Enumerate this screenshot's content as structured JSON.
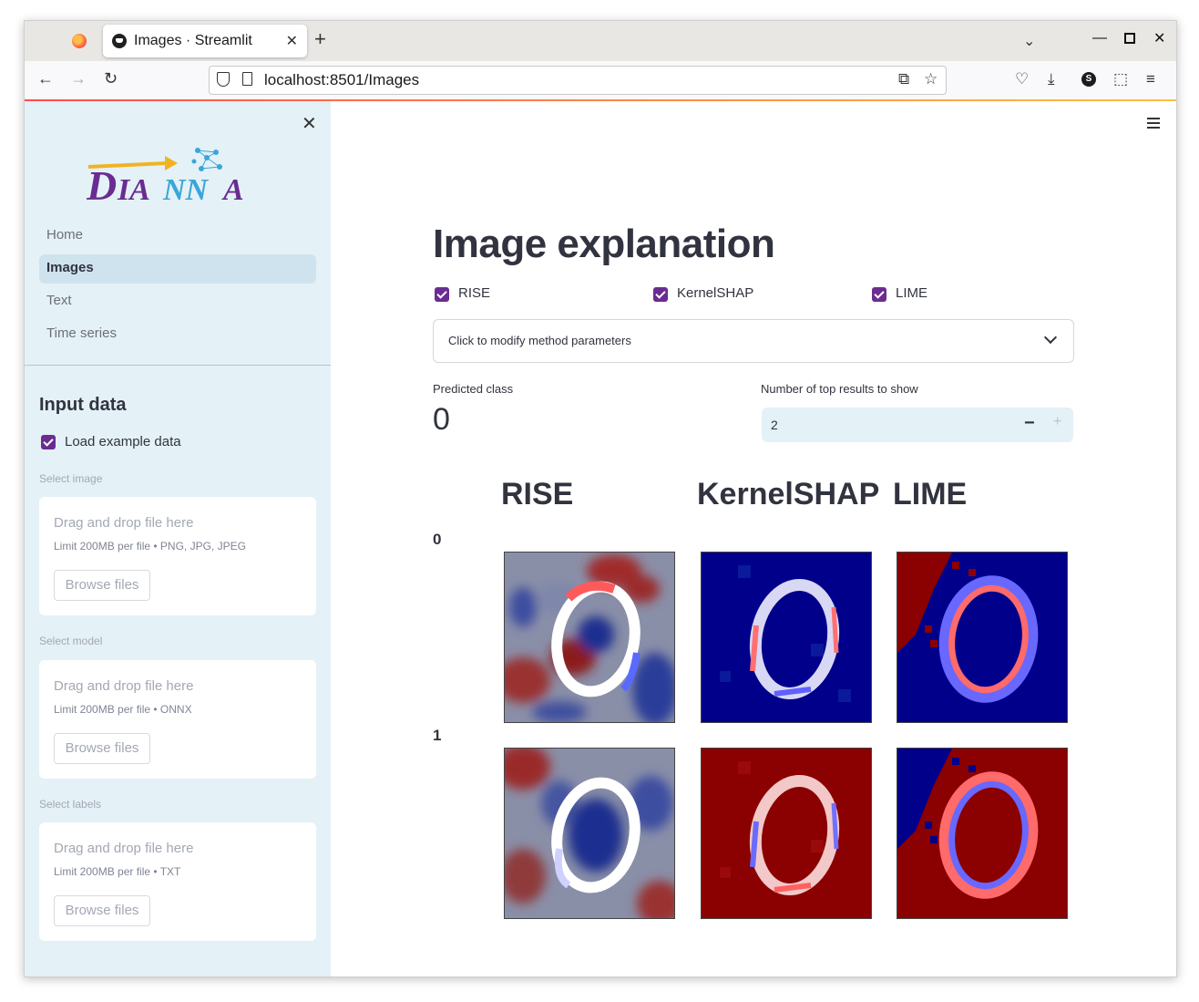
{
  "browser": {
    "tab_title": "Images · Streamlit",
    "url": "localhost:8501/Images",
    "profile_initial": "S"
  },
  "sidebar": {
    "logo_text": "DIANNA",
    "nav": [
      {
        "label": "Home",
        "active": false
      },
      {
        "label": "Images",
        "active": true
      },
      {
        "label": "Text",
        "active": false
      },
      {
        "label": "Time series",
        "active": false
      }
    ],
    "input_heading": "Input data",
    "load_example_label": "Load example data",
    "load_example_checked": true,
    "uploaders": [
      {
        "label": "Select image",
        "drop_text": "Drag and drop file here",
        "limit": "Limit 200MB per file • PNG, JPG, JPEG",
        "button": "Browse files"
      },
      {
        "label": "Select model",
        "drop_text": "Drag and drop file here",
        "limit": "Limit 200MB per file • ONNX",
        "button": "Browse files"
      },
      {
        "label": "Select labels",
        "drop_text": "Drag and drop file here",
        "limit": "Limit 200MB per file • TXT",
        "button": "Browse files"
      }
    ]
  },
  "main": {
    "title": "Image explanation",
    "methods": [
      {
        "label": "RISE",
        "checked": true
      },
      {
        "label": "KernelSHAP",
        "checked": true
      },
      {
        "label": "LIME",
        "checked": true
      }
    ],
    "expander_label": "Click to modify method parameters",
    "predicted_label": "Predicted class",
    "predicted_value": "0",
    "top_results_label": "Number of top results to show",
    "top_results_value": "2",
    "column_headers": [
      "RISE",
      "KernelSHAP",
      "LIME"
    ],
    "rows": [
      "0",
      "1"
    ]
  },
  "colors": {
    "accent": "#6a2c91",
    "sidebar_bg": "#e4f1f7",
    "heat_red": "#8b0000",
    "heat_blue": "#00008b"
  }
}
